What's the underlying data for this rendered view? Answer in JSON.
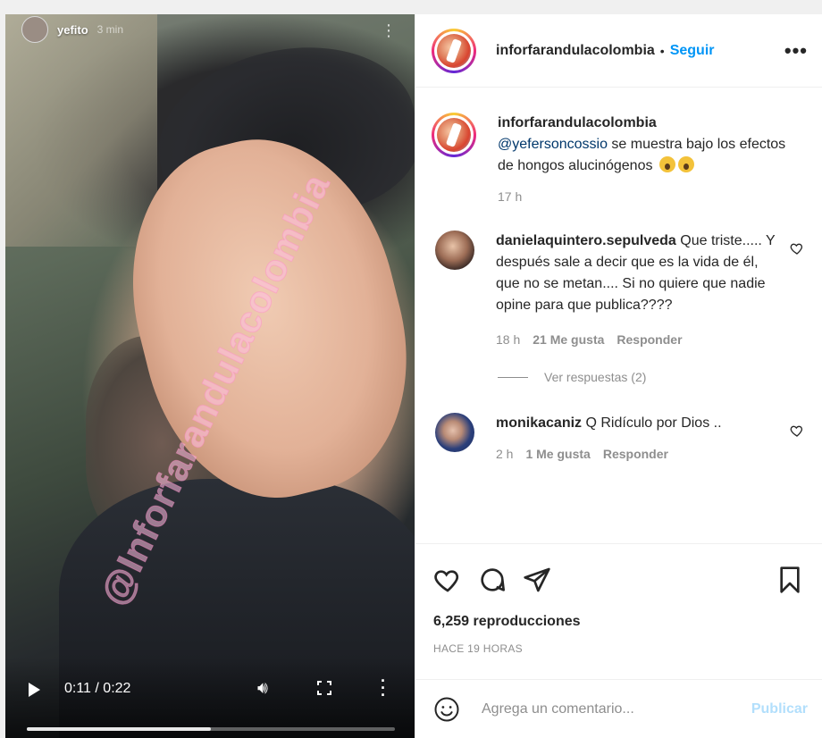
{
  "video": {
    "story_username": "yefito",
    "story_time": "3 min",
    "watermark": "@Inforfarandulacolombia",
    "current_time": "0:11",
    "duration": "0:22",
    "time_label": "0:11 / 0:22",
    "progress_fraction": 0.5
  },
  "header": {
    "username": "inforfarandulacolombia",
    "separator": "•",
    "follow_label": "Seguir",
    "more_label": "•••"
  },
  "caption": {
    "username": "inforfarandulacolombia",
    "mention": "@yefersoncossio",
    "text": " se muestra bajo los efectos de hongos alucinógenos",
    "time": "17 h"
  },
  "comments": [
    {
      "username": "danielaquintero.sepulveda",
      "text": " Que triste..... Y después sale a decir que es la vida de él, que no se metan.... Si no quiere que nadie opine para que publica????",
      "time": "18 h",
      "likes": "21 Me gusta",
      "reply_label": "Responder",
      "view_replies": "Ver respuestas (2)"
    },
    {
      "username": "monikacaniz",
      "text": " Q Ridículo por Dios ..",
      "time": "2 h",
      "likes": "1 Me gusta",
      "reply_label": "Responder"
    }
  ],
  "stats": {
    "views": "6,259 reproducciones",
    "ago": "HACE 19 HORAS"
  },
  "comment_box": {
    "placeholder": "Agrega un comentario...",
    "post_label": "Publicar"
  },
  "colors": {
    "link_blue": "#0095f6",
    "mention_blue": "#00376b",
    "muted": "#8e8e8e",
    "post_disabled": "#b2dffc"
  },
  "icons": [
    "heart-icon",
    "comment-icon",
    "share-icon",
    "bookmark-icon",
    "smiley-icon",
    "play-icon",
    "volume-icon",
    "fullscreen-icon",
    "more-vertical-icon"
  ]
}
